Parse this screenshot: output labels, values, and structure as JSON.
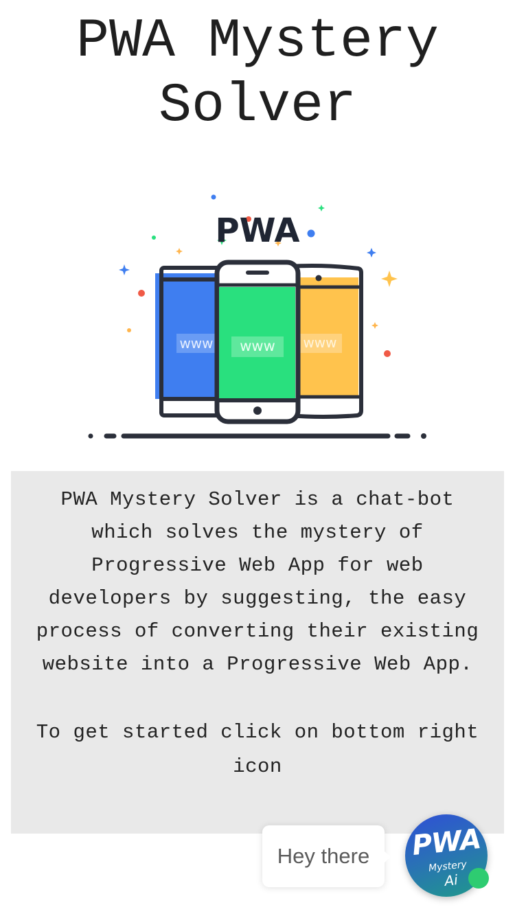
{
  "page": {
    "title": "PWA Mystery Solver"
  },
  "hero": {
    "logo_text": "PWA",
    "device_text": "www",
    "icon": "pwa-devices-illustration"
  },
  "info": {
    "description": "PWA Mystery Solver is a chat-bot which solves the mystery of Progressive Web App for web developers by suggesting, the easy process of converting their existing website into a Progressive Web App.",
    "cta": "To get started click on bottom right icon"
  },
  "chat": {
    "greeting": "Hey there",
    "launcher": {
      "line1": "PWA",
      "line2": "Mystery",
      "line3": "Ai",
      "status": "online",
      "icon": "chatbot-logo-icon"
    }
  },
  "colors": {
    "card_background": "#e9e9e9",
    "device_blue": "#3f7ef0",
    "device_green": "#29e07e",
    "device_orange": "#ffc34d",
    "outline": "#2b2f3a",
    "online": "#2ecc71",
    "launcher_gradient_start": "#2f4fd6",
    "launcher_gradient_end": "#1f9a8a"
  }
}
